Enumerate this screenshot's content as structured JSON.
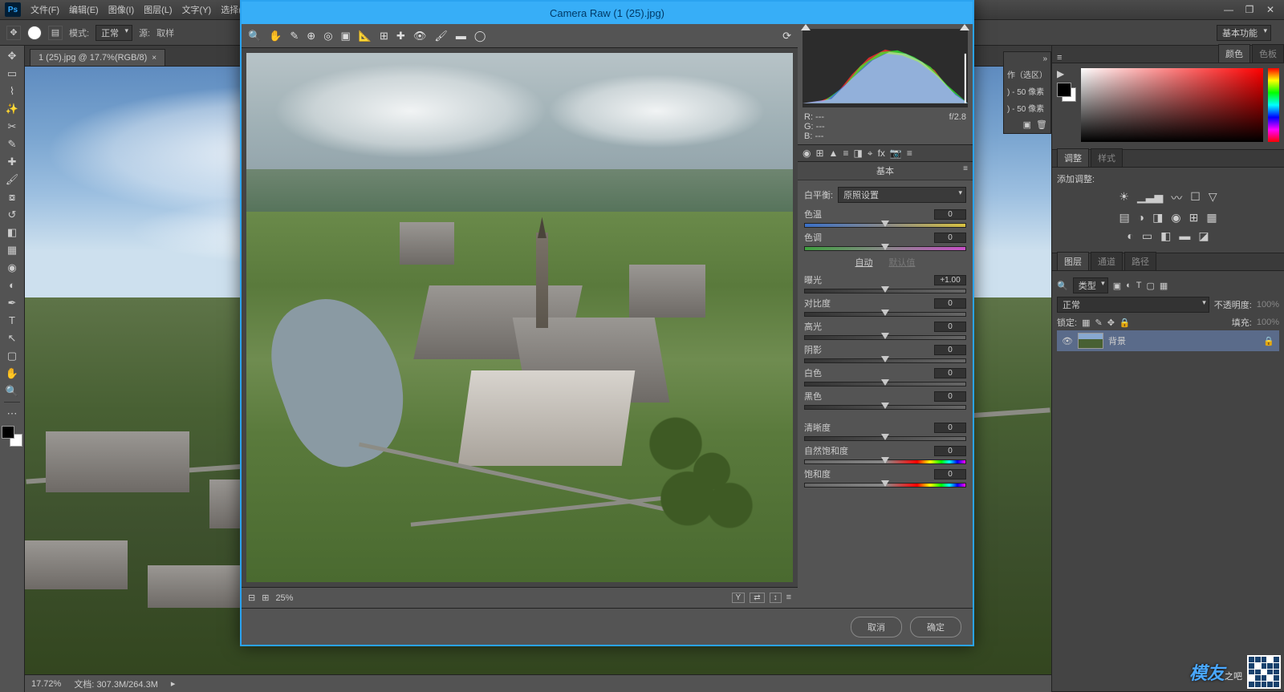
{
  "menubar": {
    "logo": "Ps",
    "items": [
      "文件(F)",
      "编辑(E)",
      "图像(I)",
      "图层(L)",
      "文字(Y)",
      "选择(S)"
    ]
  },
  "window_controls": {
    "min": "—",
    "max": "❐",
    "close": "✕"
  },
  "optionsbar": {
    "mode_label": "模式:",
    "mode_value": "正常",
    "source_label": "源:",
    "sample_label": "取样",
    "workspace": "基本功能"
  },
  "doc_tab": {
    "title": "1 (25).jpg @ 17.7%(RGB/8)",
    "close": "×"
  },
  "status": {
    "zoom": "17.72%",
    "doc_label": "文档:",
    "doc_value": "307.3M/264.3M"
  },
  "mini_panel": {
    "arrows": "»",
    "l1": "作（选区）",
    "l2": ") - 50 像素",
    "l3": ") - 50 像素"
  },
  "right": {
    "color_tabs": {
      "active": "颜色",
      "inactive": "色板"
    },
    "adjust_tabs": {
      "active": "调整",
      "inactive": "样式"
    },
    "adjust_label": "添加调整:",
    "layers_tabs": {
      "active": "图层",
      "t2": "通道",
      "t3": "路径"
    },
    "kind_placeholder": "类型",
    "blend_value": "正常",
    "opacity_label": "不透明度:",
    "opacity_value": "100%",
    "lock_label": "锁定:",
    "fill_label": "填充:",
    "fill_value": "100%",
    "layer_name": "背景"
  },
  "camera_raw": {
    "title": "Camera Raw (1 (25).jpg)",
    "zoom": "25%",
    "readout": {
      "r": "R:  ---",
      "g": "G:  ---",
      "b": "B:  ---",
      "fstop": "f/2.8"
    },
    "panel_title": "基本",
    "wb_label": "白平衡:",
    "wb_value": "原照设置",
    "auto": "自动",
    "default": "默认值",
    "sliders": {
      "temp": {
        "label": "色温",
        "value": "0"
      },
      "tint": {
        "label": "色调",
        "value": "0"
      },
      "exposure": {
        "label": "曝光",
        "value": "+1.00"
      },
      "contrast": {
        "label": "对比度",
        "value": "0"
      },
      "highlights": {
        "label": "高光",
        "value": "0"
      },
      "shadows": {
        "label": "阴影",
        "value": "0"
      },
      "whites": {
        "label": "白色",
        "value": "0"
      },
      "blacks": {
        "label": "黑色",
        "value": "0"
      },
      "clarity": {
        "label": "清晰度",
        "value": "0"
      },
      "vibrance": {
        "label": "自然饱和度",
        "value": "0"
      },
      "saturation": {
        "label": "饱和度",
        "value": "0"
      }
    },
    "cancel": "取消",
    "ok": "确定",
    "preview_box": "Y"
  },
  "watermark": {
    "brand": "模友",
    "suffix": "之吧"
  }
}
